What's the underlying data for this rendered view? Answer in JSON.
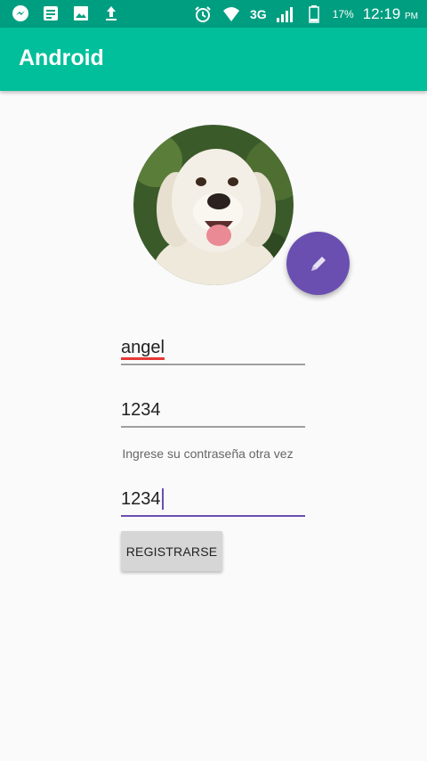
{
  "status_bar": {
    "left_icons": [
      "messenger-icon",
      "notes-icon",
      "image-icon",
      "upload-icon"
    ],
    "network": "3G",
    "battery_pct": "17%",
    "time": "12:19",
    "time_suffix": "PM"
  },
  "app_bar": {
    "title": "Android"
  },
  "profile": {
    "avatar_icon": "dog-photo",
    "edit_icon": "pencil-icon"
  },
  "form": {
    "username_value": "angel",
    "password_value": "1234",
    "confirm_hint": "Ingrese su contraseña otra vez",
    "confirm_value": "1234",
    "register_label": "REGISTRARSE"
  },
  "colors": {
    "status_bar": "#009e80",
    "app_bar": "#00bf9a",
    "fab": "#6a4fb0",
    "accent_line": "#6a4fb0"
  }
}
